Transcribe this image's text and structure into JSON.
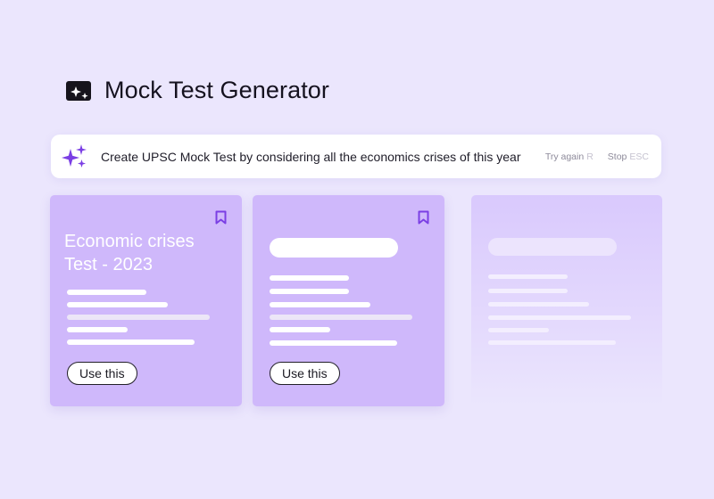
{
  "header": {
    "title": "Mock Test Generator",
    "icon": "sparkle-image-icon"
  },
  "prompt": {
    "text": "Create UPSC Mock Test by considering all the economics crises of this year",
    "icon": "sparkles-icon",
    "try_again_label": "Try again",
    "try_again_key": "R",
    "stop_label": "Stop",
    "stop_key": "ESC"
  },
  "cards": [
    {
      "title": "Economic crises Test - 2023",
      "button_label": "Use this"
    },
    {
      "button_label": "Use this"
    }
  ],
  "colors": {
    "background": "#ebe6fd",
    "card": "#cfb8fb",
    "accent": "#7b3fe4"
  }
}
